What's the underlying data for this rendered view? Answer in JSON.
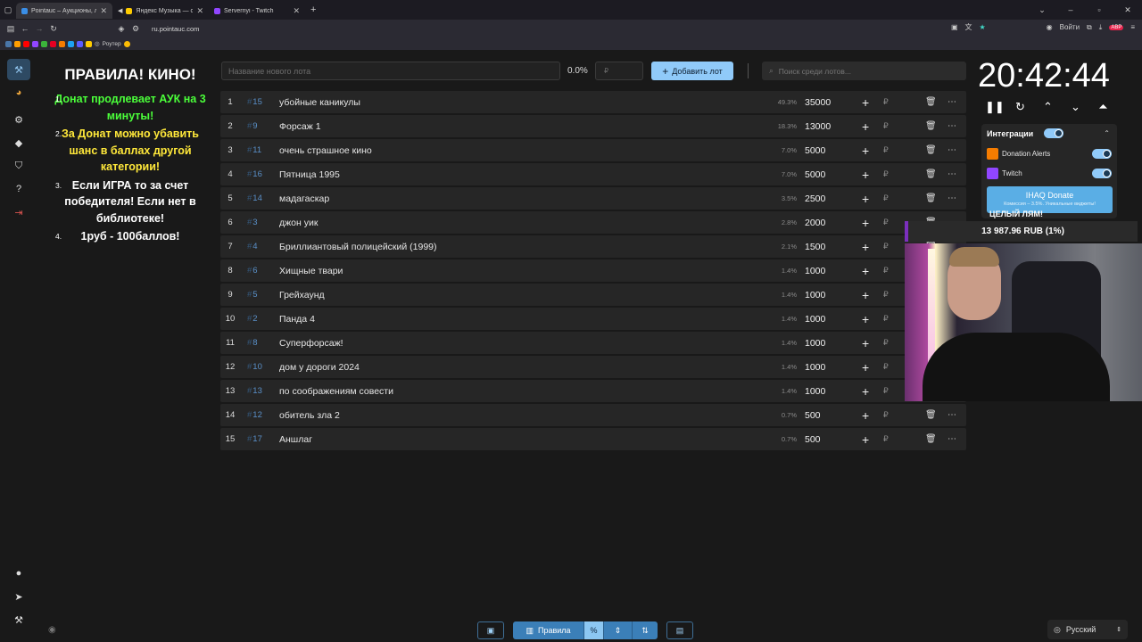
{
  "browser": {
    "tabs": [
      {
        "title": "Pointauc – Аукционы, лотереи",
        "color": "#3a8ee6"
      },
      {
        "title": "Яндекс Музыка — собираем",
        "color": "#ffcc00"
      },
      {
        "title": "Servernyi - Twitch",
        "color": "#9146ff"
      }
    ],
    "new_tab": "+",
    "url": "ru.pointauc.com",
    "login_label": "Войти",
    "bookmark_router": "Роутер"
  },
  "rules": {
    "title": "ПРАВИЛА! КИНО!",
    "items": [
      {
        "num": "1.",
        "parts": [
          {
            "text": "Донат продлевает АУК на 3 минуты!",
            "color": "green"
          }
        ]
      },
      {
        "num": "2.",
        "parts": [
          {
            "text": "За Донат можно убавить шанс в баллах другой категории!",
            "color": "yellow"
          }
        ]
      },
      {
        "num": "3.",
        "parts": [
          {
            "text": "Если ИГРА то за счет победителя! Если нет в библиотеке!",
            "color": "white"
          }
        ]
      },
      {
        "num": "4.",
        "parts": [
          {
            "text": "1руб - 100баллов!",
            "color": "white"
          }
        ]
      }
    ]
  },
  "toolbar": {
    "lot_placeholder": "Название нового лота",
    "percent": "0.0%",
    "currency_placeholder": "₽",
    "add_label": "Добавить лот",
    "search_placeholder": "Поиск среди лотов..."
  },
  "lots": [
    {
      "idx": "1",
      "id": "15",
      "name": "убойные каникулы",
      "pct": "49.3%",
      "amount": "35000"
    },
    {
      "idx": "2",
      "id": "9",
      "name": "Форсаж 1",
      "pct": "18.3%",
      "amount": "13000"
    },
    {
      "idx": "3",
      "id": "11",
      "name": "очень страшное кино",
      "pct": "7.0%",
      "amount": "5000"
    },
    {
      "idx": "4",
      "id": "16",
      "name": "Пятница 1995",
      "pct": "7.0%",
      "amount": "5000"
    },
    {
      "idx": "5",
      "id": "14",
      "name": "мадагаскар",
      "pct": "3.5%",
      "amount": "2500"
    },
    {
      "idx": "6",
      "id": "3",
      "name": "джон уик",
      "pct": "2.8%",
      "amount": "2000"
    },
    {
      "idx": "7",
      "id": "4",
      "name": "Бриллиантовый полицейский (1999)",
      "pct": "2.1%",
      "amount": "1500"
    },
    {
      "idx": "8",
      "id": "6",
      "name": "Хищные твари",
      "pct": "1.4%",
      "amount": "1000"
    },
    {
      "idx": "9",
      "id": "5",
      "name": "Грейхаунд",
      "pct": "1.4%",
      "amount": "1000"
    },
    {
      "idx": "10",
      "id": "2",
      "name": "Панда 4",
      "pct": "1.4%",
      "amount": "1000"
    },
    {
      "idx": "11",
      "id": "8",
      "name": "Суперфорсаж!",
      "pct": "1.4%",
      "amount": "1000"
    },
    {
      "idx": "12",
      "id": "10",
      "name": "дом у дороги 2024",
      "pct": "1.4%",
      "amount": "1000"
    },
    {
      "idx": "13",
      "id": "13",
      "name": "по соображениям совести",
      "pct": "1.4%",
      "amount": "1000"
    },
    {
      "idx": "14",
      "id": "12",
      "name": "обитель зла 2",
      "pct": "0.7%",
      "amount": "500"
    },
    {
      "idx": "15",
      "id": "17",
      "name": "Аншлаг",
      "pct": "0.7%",
      "amount": "500"
    }
  ],
  "row_icons": {
    "plus": "+",
    "currency": "₽",
    "delete": "trash-icon",
    "more": "⋯"
  },
  "timer": {
    "time": "20:42:44"
  },
  "integrations": {
    "header": "Интеграции",
    "items": [
      {
        "name": "Donation Alerts",
        "enabled": true
      },
      {
        "name": "Twitch",
        "enabled": true
      }
    ],
    "donate_title": "IHAQ Donate",
    "donate_sub": "Комиссия – 3.5%. Уникальные виджеты!"
  },
  "overlay": {
    "goal_caption": "ЦЕЛЫЙ ЛЯМ!",
    "goal_amount": "13 987.96 RUB (1%)"
  },
  "bottom": {
    "rules_label": "Правила",
    "percent_icon": "%",
    "language": "Русский"
  },
  "colors": {
    "accent": "#90caf9",
    "id_blue": "#5a90c8",
    "rule_green": "#4bff3a",
    "rule_yellow": "#ffe83a",
    "twitch": "#9146ff"
  }
}
